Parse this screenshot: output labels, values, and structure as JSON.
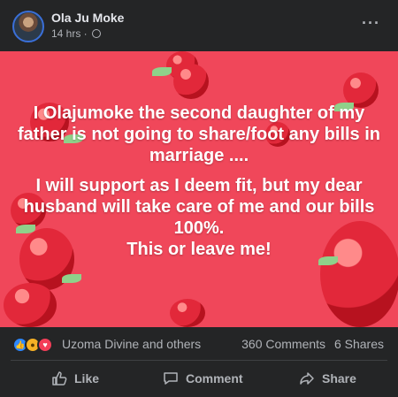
{
  "post": {
    "author": "Ola Ju Moke",
    "time": "14 hrs ·",
    "more_label": "···",
    "text_1": "I Olajumoke the second daughter of my father is not going to share/foot any bills in marriage ....",
    "text_2": "I will support as I deem fit, but my dear husband will take care of me and our bills 100%.",
    "text_3": "This or leave me!",
    "background_color": "#f0475a"
  },
  "stats": {
    "reactors": "Uzoma Divine and others",
    "comments": "360 Comments",
    "shares": "6 Shares",
    "reaction_icons": [
      "like-icon",
      "haha-icon",
      "love-icon"
    ]
  },
  "actions": {
    "like_label": "Like",
    "comment_label": "Comment",
    "share_label": "Share"
  }
}
